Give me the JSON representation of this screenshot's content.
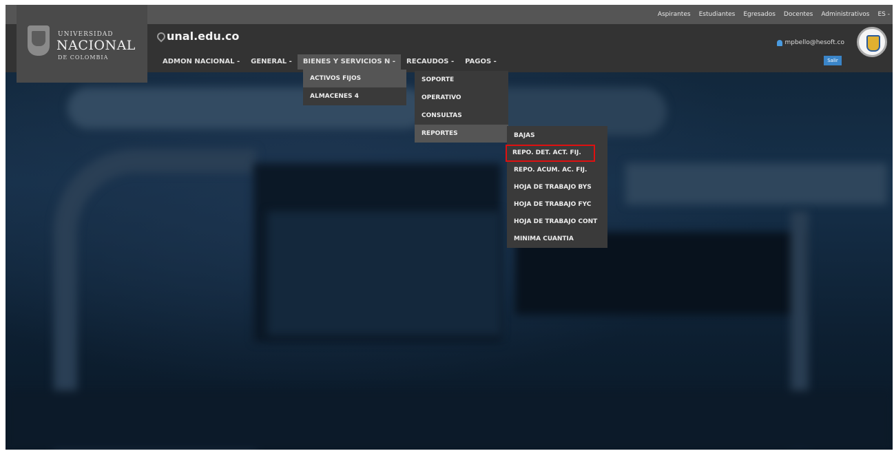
{
  "top_links": [
    "Aspirantes",
    "Estudiantes",
    "Egresados",
    "Docentes",
    "Administrativos",
    "ES -"
  ],
  "logo": {
    "line1": "UNIVERSIDAD",
    "line2": "NACIONAL",
    "line3": "DE COLOMBIA"
  },
  "domain": "unal.edu.co",
  "nav": [
    "ADMON NACIONAL -",
    "GENERAL -",
    "BIENES Y SERVICIOS N -",
    "RECAUDOS -",
    "PAGOS -"
  ],
  "user": {
    "email": "mpbello@hesoft.co",
    "logout": "Salir"
  },
  "submenu1": [
    "ACTIVOS FIJOS",
    "ALMACENES 4"
  ],
  "submenu2": [
    "SOPORTE",
    "OPERATIVO",
    "CONSULTAS",
    "REPORTES"
  ],
  "submenu3": [
    "BAJAS",
    "REPO. DET. ACT. FIJ.",
    "REPO. ACUM. AC. FIJ.",
    "HOJA DE TRABAJO BYS",
    "HOJA DE TRABAJO FYC",
    "HOJA DE TRABAJO CONT",
    "MINIMA CUANTIA"
  ],
  "colors": {
    "highlight_box": "#e01010",
    "button_blue": "#3a85c9"
  }
}
